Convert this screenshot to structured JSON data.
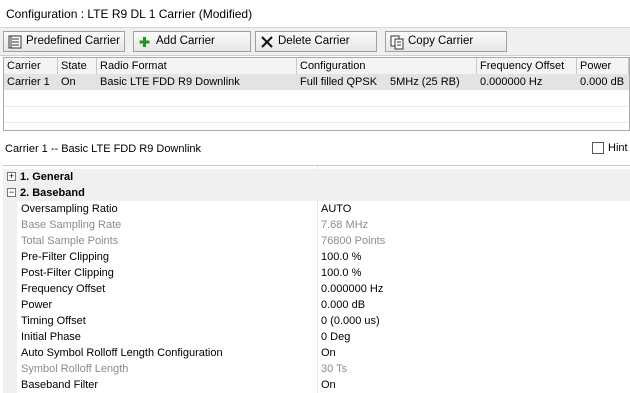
{
  "window": {
    "title": "Configuration : LTE R9 DL 1 Carrier (Modified)"
  },
  "toolbar": {
    "predefined_label": "Predefined Carrier",
    "add_label": "Add Carrier",
    "delete_label": "Delete Carrier",
    "copy_label": "Copy Carrier"
  },
  "carrier_table": {
    "headers": [
      "Carrier",
      "State",
      "Radio Format",
      "Configuration",
      "Frequency Offset",
      "Power"
    ],
    "rows": [
      {
        "carrier": "Carrier 1",
        "state": "On",
        "radio_format": "Basic LTE FDD R9 Downlink",
        "config_mod": "Full filled QPSK",
        "config_bw": "5MHz (25 RB)",
        "freq_offset": "0.000000 Hz",
        "power": "0.000 dB"
      }
    ]
  },
  "detail": {
    "title": "Carrier 1 -- Basic LTE FDD R9 Downlink",
    "hint_label": "Hint"
  },
  "properties": {
    "categories": [
      {
        "label": "1. General",
        "expanded": false
      },
      {
        "label": "2. Baseband",
        "expanded": true
      }
    ],
    "items": [
      {
        "name": "Oversampling Ratio",
        "value": "AUTO"
      },
      {
        "name": "Base Sampling Rate",
        "value": "7.68 MHz"
      },
      {
        "name": "Total Sample Points",
        "value": "76800 Points"
      },
      {
        "name": "Pre-Filter Clipping",
        "value": "100.0 %"
      },
      {
        "name": "Post-Filter Clipping",
        "value": "100.0 %"
      },
      {
        "name": "Frequency Offset",
        "value": "0.000000 Hz"
      },
      {
        "name": "Power",
        "value": "0.000 dB"
      },
      {
        "name": "Timing Offset",
        "value": "0 (0.000 us)"
      },
      {
        "name": "Initial Phase",
        "value": "0 Deg"
      },
      {
        "name": "Auto Symbol Rolloff Length Configuration",
        "value": "On"
      },
      {
        "name": "Symbol Rolloff Length",
        "value": "30 Ts"
      },
      {
        "name": "Baseband Filter",
        "value": "On"
      }
    ]
  },
  "icons": {
    "predefined": "list-table-icon",
    "add": "green-plus-icon",
    "delete": "black-x-icon",
    "copy": "copy-icon"
  },
  "colors": {
    "selected_row": "#e3e3e3",
    "disabled_text": "#8c8c8c",
    "add_green": "#1a9a1a"
  }
}
